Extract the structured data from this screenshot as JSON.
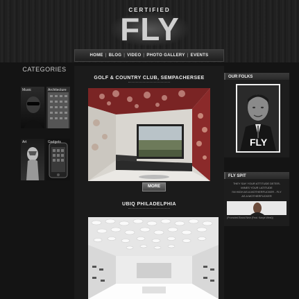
{
  "header": {
    "logo_top": "CERTIFIED",
    "logo_main": "FLY"
  },
  "nav": {
    "items": [
      "HOME",
      "BLOG",
      "VIDEO",
      "PHOTO GALLERY",
      "EVENTS"
    ]
  },
  "sidebar": {
    "title": "CATEGORIES",
    "categories": [
      {
        "label": "Music",
        "icon": "musician-photo"
      },
      {
        "label": "Architecture",
        "icon": "building-photo"
      },
      {
        "label": "Art",
        "icon": "statue-photo"
      },
      {
        "label": "Gadgets",
        "icon": "phone-photo"
      }
    ]
  },
  "posts": [
    {
      "title": "GOLF & COUNTRY CLUB, SEMPACHERSEE",
      "more_label": "MORE"
    },
    {
      "title": "UBIQ PHILADELPHIA"
    }
  ],
  "right": {
    "folks_title": "OUR FOLKS",
    "folks_badge": "FLY",
    "spit_title": "FLY SPIT",
    "spit_lines": [
      "THEY SAY YOUR ATTITUDE DETER-",
      "MINES YOUR LATITUDE",
      "I'M HIGH AS A MOTHERFUCKER - FLY",
      "AS A MOTHERFUCKER"
    ],
    "spit_credit": "(Promoted Brand New (Feat. Kanye West))"
  },
  "colors": {
    "background": "#141414",
    "panel": "#1b1b1b",
    "accent": "#d0d0d0"
  }
}
